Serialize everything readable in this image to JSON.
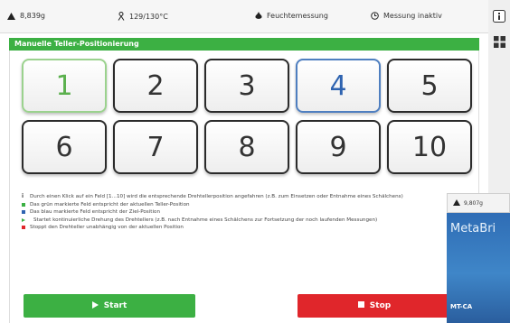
{
  "status": {
    "weight": "8,839g",
    "temperature": "129/130°C",
    "moisture": "Feuchtemessung",
    "measurement": "Messung inaktiv"
  },
  "panel": {
    "title": "Manuelle Teller-Positionierung"
  },
  "positions": [
    "1",
    "2",
    "3",
    "4",
    "5",
    "6",
    "7",
    "8",
    "9",
    "10"
  ],
  "legend": [
    "Durch einen Klick auf ein Feld [1...10] wird die entsprechende Drehtellerposition angefahren (z.B. zum Einsetzen oder Entnahme eines Schälchens)",
    "Das grün markierte Feld entspricht der aktuellen Teller-Position",
    "Das blau markierte Feld entspricht der Ziel-Position",
    "Startet kontinuierliche Drehung des Drehtellers (z.B. nach Entnahme eines Schälchens zur Fortsetzung der noch laufenden Messungen)",
    "Stoppt den Drehteller unabhängig von der aktuellen Position"
  ],
  "buttons": {
    "start": "Start",
    "stop": "Stop"
  },
  "overlay": {
    "weight": "9,807g",
    "brand": "MetaBri",
    "model": "MT-CA"
  },
  "colors": {
    "green": "#3cb043",
    "blue": "#2e63b0",
    "red": "#e0262b"
  }
}
